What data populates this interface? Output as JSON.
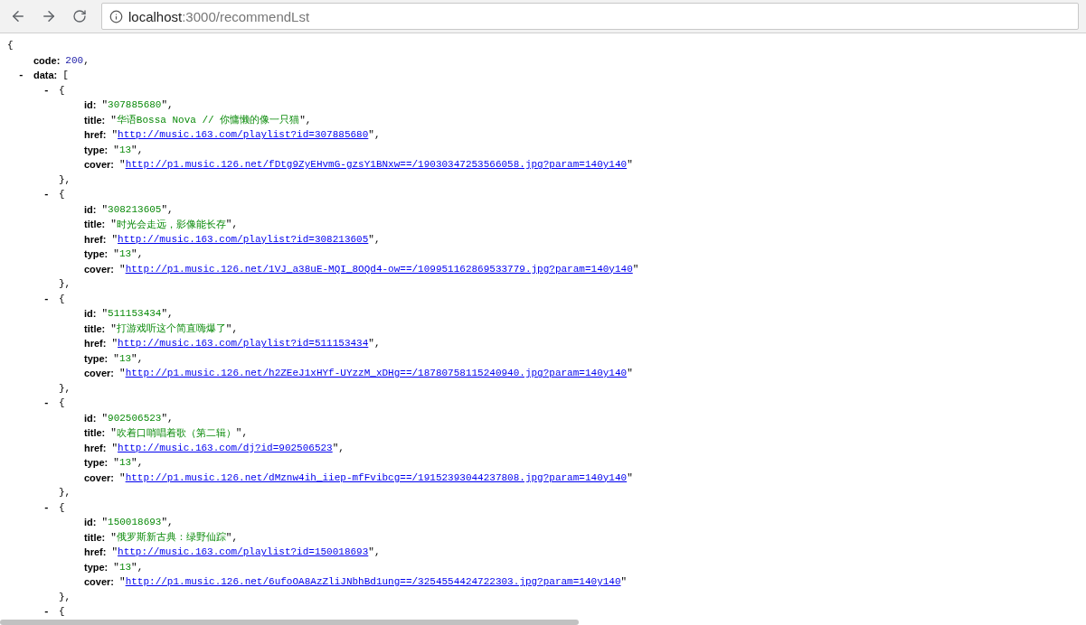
{
  "browser": {
    "url_host": "localhost",
    "url_path": ":3000/recommendLst"
  },
  "document": {
    "tokens": [
      {
        "kind": "punct",
        "text": "{"
      }
    ],
    "children": [
      {
        "key": "code:",
        "tokens": [
          {
            "kind": "number",
            "text": "200"
          },
          {
            "kind": "punct",
            "text": ","
          }
        ]
      },
      {
        "toggle": "-",
        "key": "data:",
        "tokens": [
          {
            "kind": "punct",
            "text": "["
          }
        ],
        "children": [
          {
            "toggle": "-",
            "tokens": [
              {
                "kind": "punct",
                "text": "{"
              }
            ],
            "close": "},",
            "children": [
              {
                "key": "id:",
                "tokens": [
                  {
                    "kind": "punct",
                    "text": "\""
                  },
                  {
                    "kind": "string",
                    "text": "307885680"
                  },
                  {
                    "kind": "punct",
                    "text": "\","
                  }
                ]
              },
              {
                "key": "title:",
                "tokens": [
                  {
                    "kind": "punct",
                    "text": "\""
                  },
                  {
                    "kind": "string",
                    "text": "华语Bossa Nova // 你慵懒的像一只猫"
                  },
                  {
                    "kind": "punct",
                    "text": "\","
                  }
                ]
              },
              {
                "key": "href:",
                "tokens": [
                  {
                    "kind": "punct",
                    "text": "\""
                  },
                  {
                    "kind": "link",
                    "text": "http://music.163.com/playlist?id=307885680"
                  },
                  {
                    "kind": "punct",
                    "text": "\","
                  }
                ]
              },
              {
                "key": "type:",
                "tokens": [
                  {
                    "kind": "punct",
                    "text": "\""
                  },
                  {
                    "kind": "string",
                    "text": "13"
                  },
                  {
                    "kind": "punct",
                    "text": "\","
                  }
                ]
              },
              {
                "key": "cover:",
                "tokens": [
                  {
                    "kind": "punct",
                    "text": "\""
                  },
                  {
                    "kind": "link",
                    "text": "http://p1.music.126.net/fDtg9ZyEHvmG-gzsY1BNxw==/19030347253566058.jpg?param=140y140"
                  },
                  {
                    "kind": "punct",
                    "text": "\""
                  }
                ]
              }
            ]
          },
          {
            "toggle": "-",
            "tokens": [
              {
                "kind": "punct",
                "text": "{"
              }
            ],
            "close": "},",
            "children": [
              {
                "key": "id:",
                "tokens": [
                  {
                    "kind": "punct",
                    "text": "\""
                  },
                  {
                    "kind": "string",
                    "text": "308213605"
                  },
                  {
                    "kind": "punct",
                    "text": "\","
                  }
                ]
              },
              {
                "key": "title:",
                "tokens": [
                  {
                    "kind": "punct",
                    "text": "\""
                  },
                  {
                    "kind": "string",
                    "text": "时光会走远，影像能长存"
                  },
                  {
                    "kind": "punct",
                    "text": "\","
                  }
                ]
              },
              {
                "key": "href:",
                "tokens": [
                  {
                    "kind": "punct",
                    "text": "\""
                  },
                  {
                    "kind": "link",
                    "text": "http://music.163.com/playlist?id=308213605"
                  },
                  {
                    "kind": "punct",
                    "text": "\","
                  }
                ]
              },
              {
                "key": "type:",
                "tokens": [
                  {
                    "kind": "punct",
                    "text": "\""
                  },
                  {
                    "kind": "string",
                    "text": "13"
                  },
                  {
                    "kind": "punct",
                    "text": "\","
                  }
                ]
              },
              {
                "key": "cover:",
                "tokens": [
                  {
                    "kind": "punct",
                    "text": "\""
                  },
                  {
                    "kind": "link",
                    "text": "http://p1.music.126.net/1VJ_a38uE-MQI_8OQd4-ow==/109951162869533779.jpg?param=140y140"
                  },
                  {
                    "kind": "punct",
                    "text": "\""
                  }
                ]
              }
            ]
          },
          {
            "toggle": "-",
            "tokens": [
              {
                "kind": "punct",
                "text": "{"
              }
            ],
            "close": "},",
            "children": [
              {
                "key": "id:",
                "tokens": [
                  {
                    "kind": "punct",
                    "text": "\""
                  },
                  {
                    "kind": "string",
                    "text": "511153434"
                  },
                  {
                    "kind": "punct",
                    "text": "\","
                  }
                ]
              },
              {
                "key": "title:",
                "tokens": [
                  {
                    "kind": "punct",
                    "text": "\""
                  },
                  {
                    "kind": "string",
                    "text": "打游戏听这个简直嗨爆了"
                  },
                  {
                    "kind": "punct",
                    "text": "\","
                  }
                ]
              },
              {
                "key": "href:",
                "tokens": [
                  {
                    "kind": "punct",
                    "text": "\""
                  },
                  {
                    "kind": "link",
                    "text": "http://music.163.com/playlist?id=511153434"
                  },
                  {
                    "kind": "punct",
                    "text": "\","
                  }
                ]
              },
              {
                "key": "type:",
                "tokens": [
                  {
                    "kind": "punct",
                    "text": "\""
                  },
                  {
                    "kind": "string",
                    "text": "13"
                  },
                  {
                    "kind": "punct",
                    "text": "\","
                  }
                ]
              },
              {
                "key": "cover:",
                "tokens": [
                  {
                    "kind": "punct",
                    "text": "\""
                  },
                  {
                    "kind": "link",
                    "text": "http://p1.music.126.net/h2ZEeJ1xHYf-UYzzM_xDHg==/18780758115240940.jpg?param=140y140"
                  },
                  {
                    "kind": "punct",
                    "text": "\""
                  }
                ]
              }
            ]
          },
          {
            "toggle": "-",
            "tokens": [
              {
                "kind": "punct",
                "text": "{"
              }
            ],
            "close": "},",
            "children": [
              {
                "key": "id:",
                "tokens": [
                  {
                    "kind": "punct",
                    "text": "\""
                  },
                  {
                    "kind": "string",
                    "text": "902506523"
                  },
                  {
                    "kind": "punct",
                    "text": "\","
                  }
                ]
              },
              {
                "key": "title:",
                "tokens": [
                  {
                    "kind": "punct",
                    "text": "\""
                  },
                  {
                    "kind": "string",
                    "text": "吹着口哨唱着歌（第二辑）"
                  },
                  {
                    "kind": "punct",
                    "text": "\","
                  }
                ]
              },
              {
                "key": "href:",
                "tokens": [
                  {
                    "kind": "punct",
                    "text": "\""
                  },
                  {
                    "kind": "link",
                    "text": "http://music.163.com/dj?id=902506523"
                  },
                  {
                    "kind": "punct",
                    "text": "\","
                  }
                ]
              },
              {
                "key": "type:",
                "tokens": [
                  {
                    "kind": "punct",
                    "text": "\""
                  },
                  {
                    "kind": "string",
                    "text": "13"
                  },
                  {
                    "kind": "punct",
                    "text": "\","
                  }
                ]
              },
              {
                "key": "cover:",
                "tokens": [
                  {
                    "kind": "punct",
                    "text": "\""
                  },
                  {
                    "kind": "link",
                    "text": "http://p1.music.126.net/dMznw4ih_iiep-mfFvibcg==/19152393044237808.jpg?param=140y140"
                  },
                  {
                    "kind": "punct",
                    "text": "\""
                  }
                ]
              }
            ]
          },
          {
            "toggle": "-",
            "tokens": [
              {
                "kind": "punct",
                "text": "{"
              }
            ],
            "close": "},",
            "children": [
              {
                "key": "id:",
                "tokens": [
                  {
                    "kind": "punct",
                    "text": "\""
                  },
                  {
                    "kind": "string",
                    "text": "150018693"
                  },
                  {
                    "kind": "punct",
                    "text": "\","
                  }
                ]
              },
              {
                "key": "title:",
                "tokens": [
                  {
                    "kind": "punct",
                    "text": "\""
                  },
                  {
                    "kind": "string",
                    "text": "俄罗斯新古典：绿野仙踪"
                  },
                  {
                    "kind": "punct",
                    "text": "\","
                  }
                ]
              },
              {
                "key": "href:",
                "tokens": [
                  {
                    "kind": "punct",
                    "text": "\""
                  },
                  {
                    "kind": "link",
                    "text": "http://music.163.com/playlist?id=150018693"
                  },
                  {
                    "kind": "punct",
                    "text": "\","
                  }
                ]
              },
              {
                "key": "type:",
                "tokens": [
                  {
                    "kind": "punct",
                    "text": "\""
                  },
                  {
                    "kind": "string",
                    "text": "13"
                  },
                  {
                    "kind": "punct",
                    "text": "\","
                  }
                ]
              },
              {
                "key": "cover:",
                "tokens": [
                  {
                    "kind": "punct",
                    "text": "\""
                  },
                  {
                    "kind": "link",
                    "text": "http://p1.music.126.net/6ufoOA8AzZliJNbhBd1ung==/3254554424722303.jpg?param=140y140"
                  },
                  {
                    "kind": "punct",
                    "text": "\""
                  }
                ]
              }
            ]
          },
          {
            "toggle": "-",
            "tokens": [
              {
                "kind": "punct",
                "text": "{"
              }
            ]
          }
        ]
      }
    ]
  }
}
